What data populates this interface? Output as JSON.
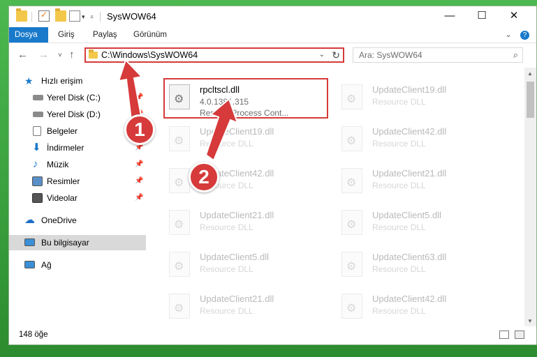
{
  "window": {
    "title": "SysWOW64",
    "minimize": "—",
    "maximize": "☐",
    "close": "✕"
  },
  "ribbon": {
    "tabs": [
      "Dosya",
      "Giriş",
      "Paylaş",
      "Görünüm"
    ],
    "expand": "⌄",
    "help": "?"
  },
  "nav": {
    "back": "←",
    "forward": "→",
    "recent": "˅",
    "up": "↑",
    "address": "C:\\Windows\\SysWOW64",
    "address_drop": "⌄",
    "refresh": "↻",
    "search_placeholder": "Ara: SysWOW64",
    "search_icon": "⌕"
  },
  "sidebar": {
    "items": [
      {
        "label": "Hızlı erişim",
        "icon": "star-icon",
        "pinned": false
      },
      {
        "label": "Yerel Disk (C:)",
        "icon": "drive-icon",
        "pinned": true
      },
      {
        "label": "Yerel Disk (D:)",
        "icon": "drive-icon",
        "pinned": true
      },
      {
        "label": "Belgeler",
        "icon": "document-icon",
        "pinned": true
      },
      {
        "label": "İndirmeler",
        "icon": "download-icon",
        "pinned": true
      },
      {
        "label": "Müzik",
        "icon": "music-icon",
        "pinned": true
      },
      {
        "label": "Resimler",
        "icon": "pictures-icon",
        "pinned": true
      },
      {
        "label": "Videolar",
        "icon": "video-icon",
        "pinned": true
      },
      {
        "label": "OneDrive",
        "icon": "cloud-icon",
        "pinned": false
      },
      {
        "label": "Bu bilgisayar",
        "icon": "computer-icon",
        "pinned": false,
        "selected": true
      },
      {
        "label": "Ağ",
        "icon": "network-icon",
        "pinned": false
      }
    ],
    "pin_glyph": "📌"
  },
  "files": {
    "highlighted": {
      "name": "rpcltscl.dll",
      "version": "4.0.1381.315",
      "description": "Remote Process Cont..."
    },
    "left_column": [
      {
        "name": "UpdateClient19.dll",
        "type": "Resource DLL"
      },
      {
        "name": "UpdateClient42.dll",
        "type": "Resource DLL"
      },
      {
        "name": "UpdateClient21.dll",
        "type": "Resource DLL"
      },
      {
        "name": "UpdateClient5.dll",
        "type": "Resource DLL"
      },
      {
        "name": "UpdateClient21.dll",
        "type": "Resource DLL"
      }
    ],
    "right_column": [
      {
        "name": "UpdateClient19.dll",
        "type": "Resource DLL"
      },
      {
        "name": "UpdateClient42.dll",
        "type": "Resource DLL"
      },
      {
        "name": "UpdateClient21.dll",
        "type": "Resource DLL"
      },
      {
        "name": "UpdateClient5.dll",
        "type": "Resource DLL"
      },
      {
        "name": "UpdateClient63.dll",
        "type": "Resource DLL"
      },
      {
        "name": "UpdateClient42.dll",
        "type": "Resource DLL"
      }
    ]
  },
  "status": {
    "count": "148 öğe"
  },
  "annotations": {
    "step1": "1",
    "step2": "2",
    "accent_color": "#d63a3a"
  }
}
